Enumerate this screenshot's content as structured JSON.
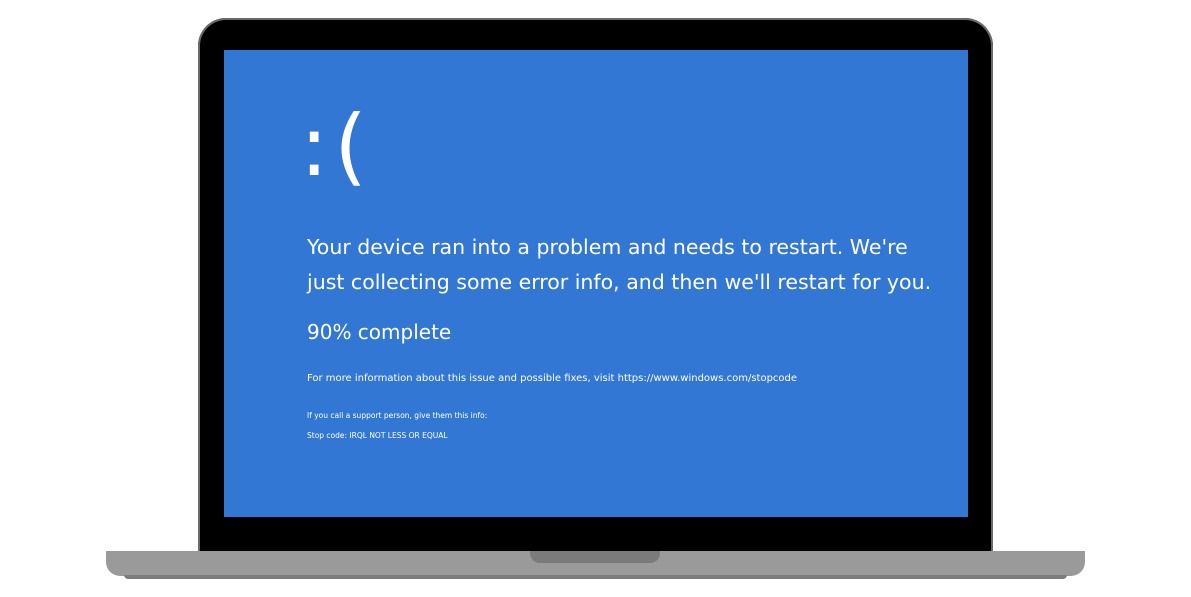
{
  "screen": {
    "background_color": "#3277d3",
    "text_color": "#ffffff",
    "sad_face": ":(",
    "message": "Your device ran into a problem and needs to restart. We're just collecting some error info, and then we'll restart for you.",
    "progress_percent": 90,
    "progress_text": "90% complete",
    "more_info_text": "For more information about this issue and possible fixes, visit https://www.windows.com/stopcode",
    "support_text": "If you call a support person, give them this info:",
    "stop_code_text": "Stop code: IRQL NOT LESS OR EQUAL"
  },
  "device": {
    "bezel_color": "#000000",
    "base_color": "#9a9a9a"
  }
}
